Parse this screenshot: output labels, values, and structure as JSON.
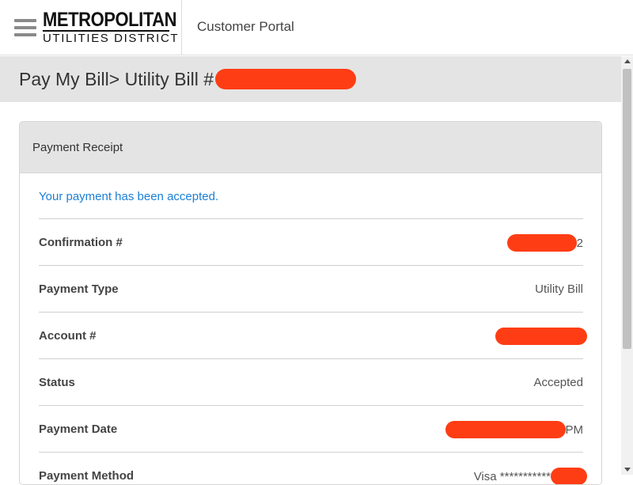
{
  "header": {
    "logo_line1": "METROPOLITAN",
    "logo_line2": "UTILITIES DISTRICT",
    "portal_title": "Customer Portal"
  },
  "breadcrumb": {
    "parent": "Pay My Bill",
    "separator": ">",
    "current_prefix": "Utility Bill #"
  },
  "receipt": {
    "title": "Payment Receipt",
    "message": "Your payment has been accepted.",
    "rows": [
      {
        "label": "Confirmation #",
        "suffix": "2"
      },
      {
        "label": "Payment Type",
        "value": "Utility Bill"
      },
      {
        "label": "Account #"
      },
      {
        "label": "Status",
        "value": "Accepted"
      },
      {
        "label": "Payment Date",
        "suffix": "PM"
      },
      {
        "label": "Payment Method",
        "prefix": "Visa ***********"
      }
    ]
  },
  "colors": {
    "accent_blue": "#1a7fd6",
    "redaction": "#ff3d14",
    "panel_gray": "#e4e4e4"
  }
}
